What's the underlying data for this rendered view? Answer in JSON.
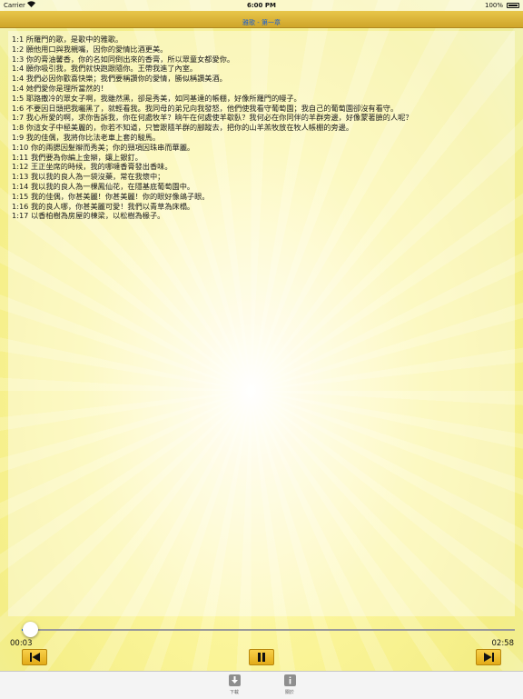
{
  "status_bar": {
    "carrier": "Carrier",
    "time": "6:00 PM",
    "battery": "100%"
  },
  "title": "雅歌 - 第一章",
  "verses": [
    "1:1 所羅門的歌，是歌中的雅歌。",
    "1:2 願他用口與我親嘴，因你的愛情比酒更美。",
    "1:3 你的膏油馨香，你的名如同倒出來的香膏，所以眾童女都愛你。",
    "1:4 願你吸引我，我們就快跑跟隨你。王帶我進了內室。",
    "1:4 我們必因你歡喜快樂；我們要稱讚你的愛情，勝似稱讚美酒。",
    "1:4 她們愛你是理所當然的！",
    "1:5 耶路撒冷的眾女子啊，我雖然黑，卻是秀美，如同基達的帳棚，好像所羅門的幔子。",
    "1:6 不要因日頭把我曬黑了，就輕看我。我同母的弟兄向我發怒，他們使我看守葡萄園；我自己的葡萄園卻沒有看守。",
    "1:7 我心所愛的啊，求你告訴我，你在何處牧羊？晌午在何處使羊歇臥？我何必在你同伴的羊群旁邊，好像蒙著臉的人呢？",
    "1:8 你這女子中極美麗的，你若不知道，只管跟隨羊群的腳蹤去，把你的山羊羔牧放在牧人帳棚的旁邊。",
    "1:9 我的佳偶，我將你比法老車上套的駿馬。",
    "1:10 你的兩腮因髮辮而秀美；你的頸項因珠串而華麗。",
    "1:11 我們要為你編上金辮，鑲上銀釘。",
    "1:12 王正坐席的時候，我的哪噠香膏發出香味。",
    "1:13 我以我的良人為一袋沒藥，常在我懷中；",
    "1:14 我以我的良人為一棵鳳仙花，在隱基底葡萄園中。",
    "1:15 我的佳偶，你甚美麗！你甚美麗！你的眼好像鴿子眼。",
    "1:16 我的良人哪，你甚美麗可愛！我們以青草為床榻。",
    "1:17 以香柏樹為房屋的棟梁，以松樹為椽子。"
  ],
  "player": {
    "elapsed": "00:03",
    "duration": "02:58",
    "progress_fraction": 0.017
  },
  "tabs": {
    "download": "下載",
    "about": "關於"
  }
}
